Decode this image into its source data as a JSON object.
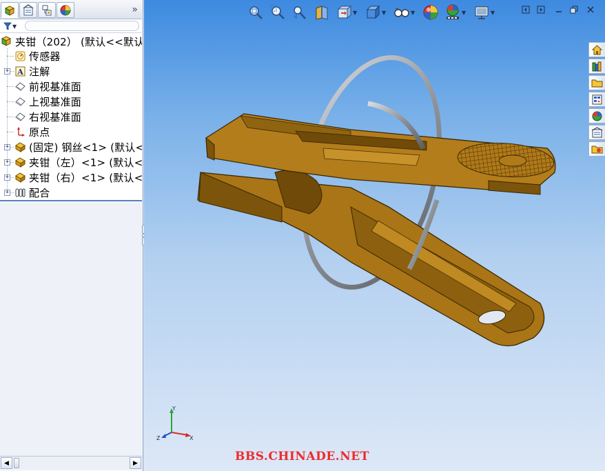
{
  "panel": {
    "tabs": [
      {
        "name": "feature-manager",
        "icon": "feature-tree-icon"
      },
      {
        "name": "property-manager",
        "icon": "property-manager-icon"
      },
      {
        "name": "configuration-manager",
        "icon": "configuration-manager-icon"
      },
      {
        "name": "display-manager",
        "icon": "display-manager-icon"
      }
    ],
    "more_label": "»",
    "filter_icon": "filter-icon"
  },
  "tree": {
    "root": "夹钳（202） (默认<<默认",
    "items": [
      {
        "label": "传感器",
        "icon": "sensor-icon",
        "expandable": false
      },
      {
        "label": "注解",
        "icon": "annotation-icon",
        "expandable": true
      },
      {
        "label": "前视基准面",
        "icon": "plane-icon",
        "expandable": false
      },
      {
        "label": "上视基准面",
        "icon": "plane-icon",
        "expandable": false
      },
      {
        "label": "右视基准面",
        "icon": "plane-icon",
        "expandable": false
      },
      {
        "label": "原点",
        "icon": "origin-icon",
        "expandable": false
      },
      {
        "label": "(固定) 钢丝<1> (默认<",
        "icon": "part-icon",
        "expandable": true
      },
      {
        "label": "夹钳（左）<1> (默认<",
        "icon": "part-icon",
        "expandable": true
      },
      {
        "label": "夹钳（右）<1> (默认<",
        "icon": "part-icon",
        "expandable": true
      },
      {
        "label": "配合",
        "icon": "mates-icon",
        "expandable": true
      }
    ]
  },
  "view_toolbar": [
    {
      "name": "zoom-to-fit",
      "icon": "zoom-to-fit-icon"
    },
    {
      "name": "zoom-to-area",
      "icon": "zoom-to-area-icon"
    },
    {
      "name": "previous-view",
      "icon": "previous-view-icon"
    },
    {
      "name": "section-view",
      "icon": "section-view-icon"
    },
    {
      "name": "view-orientation",
      "icon": "view-orientation-icon"
    },
    {
      "name": "display-style",
      "icon": "display-style-icon"
    },
    {
      "name": "hide-show-items",
      "icon": "hide-show-icon"
    },
    {
      "name": "edit-appearance",
      "icon": "appearance-icon"
    },
    {
      "name": "apply-scene",
      "icon": "scene-icon"
    },
    {
      "name": "view-settings",
      "icon": "view-settings-icon"
    }
  ],
  "task_pane": [
    {
      "name": "solidworks-resources",
      "icon": "home-icon"
    },
    {
      "name": "design-library",
      "icon": "design-library-icon"
    },
    {
      "name": "file-explorer",
      "icon": "folder-icon"
    },
    {
      "name": "view-palette",
      "icon": "view-palette-icon"
    },
    {
      "name": "appearances-scenes",
      "icon": "appearances-icon"
    },
    {
      "name": "custom-properties",
      "icon": "custom-properties-icon"
    },
    {
      "name": "document-recovery",
      "icon": "recovery-folder-icon"
    }
  ],
  "triad": {
    "x": "X",
    "y": "Y",
    "z": "Z"
  },
  "watermark": "BBS.CHINADE.NET",
  "colors": {
    "model": "#a97516",
    "wire": "#9a9ea4",
    "viewport_top": "#3d8ae0",
    "viewport_bottom": "#dde8f7",
    "watermark": "#ee2a2a"
  }
}
